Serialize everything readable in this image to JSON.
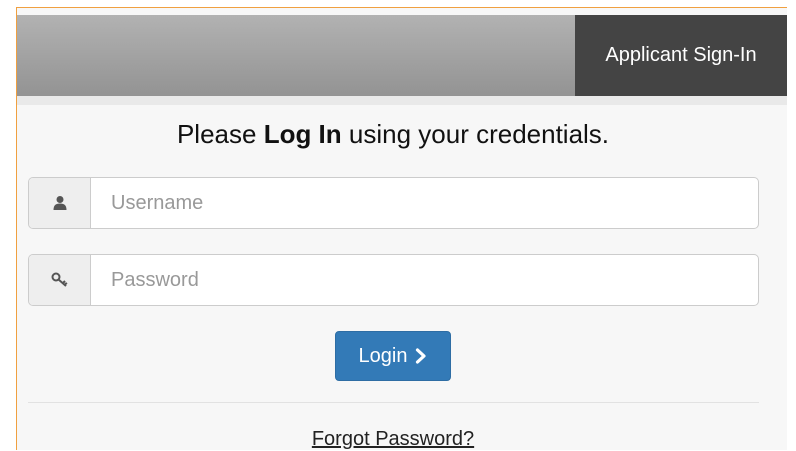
{
  "header": {
    "tab_label": "Applicant Sign-In"
  },
  "form": {
    "title_prefix": "Please ",
    "title_bold": "Log In",
    "title_suffix": " using your credentials.",
    "username": {
      "placeholder": "Username",
      "value": "",
      "icon": "user-icon"
    },
    "password": {
      "placeholder": "Password",
      "value": "",
      "icon": "key-icon"
    },
    "login_label": "Login",
    "login_icon": "chevron-right-icon",
    "forgot_label": "Forgot Password?"
  },
  "colors": {
    "accent": "#337ab7",
    "header_tab": "#444444",
    "frame_border": "#f0a040"
  }
}
